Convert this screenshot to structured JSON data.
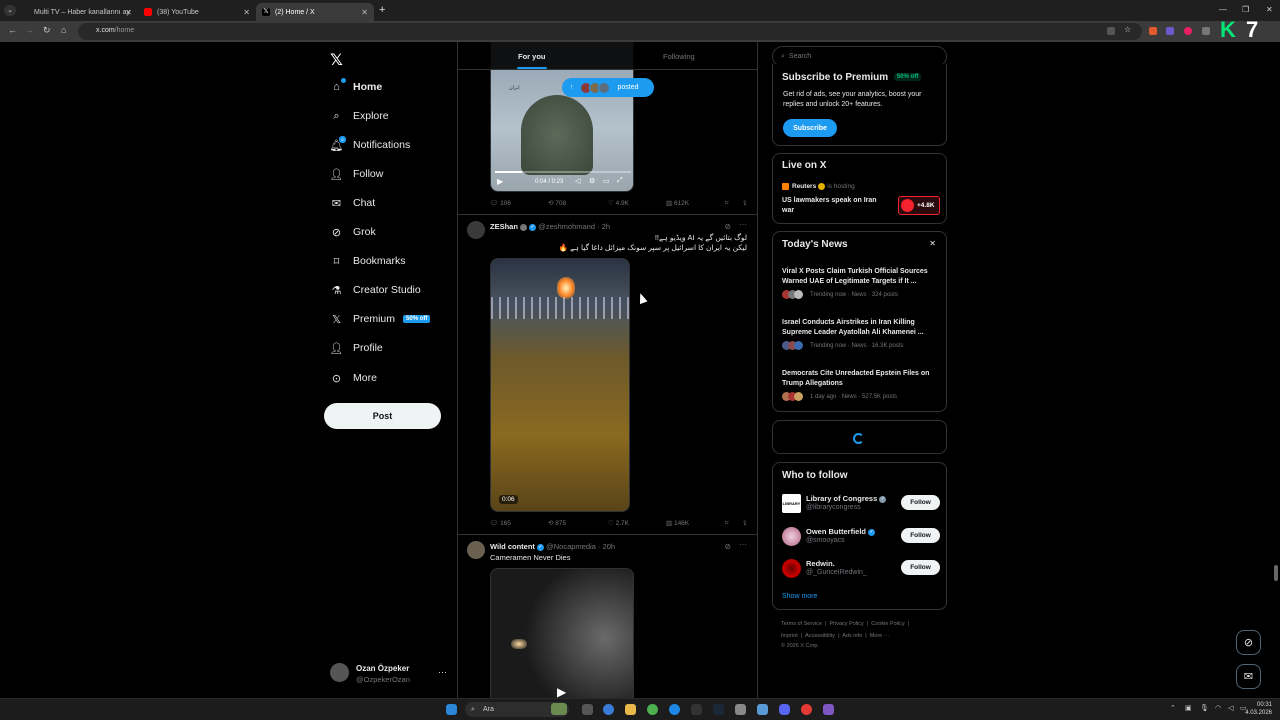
{
  "browser": {
    "tabs": [
      {
        "label": "Multi TV – Haber kanallarını ay",
        "active": false
      },
      {
        "label": "(38) YouTube",
        "active": false
      },
      {
        "label": "(2) Home / X",
        "active": true
      }
    ],
    "url_host": "x.com",
    "url_path": "/home",
    "overlay_logo_k": "K",
    "overlay_logo_num": "7"
  },
  "sidebar": {
    "items": [
      {
        "label": "Home",
        "icon": "home-icon"
      },
      {
        "label": "Explore",
        "icon": "search-icon"
      },
      {
        "label": "Notifications",
        "icon": "bell-icon"
      },
      {
        "label": "Follow",
        "icon": "person-add-icon"
      },
      {
        "label": "Chat",
        "icon": "mail-icon"
      },
      {
        "label": "Grok",
        "icon": "grok-icon"
      },
      {
        "label": "Bookmarks",
        "icon": "bookmark-icon"
      },
      {
        "label": "Creator Studio",
        "icon": "flask-icon"
      },
      {
        "label": "Premium",
        "icon": "x-logo-icon"
      },
      {
        "label": "Profile",
        "icon": "person-icon"
      },
      {
        "label": "More",
        "icon": "more-circle-icon"
      }
    ],
    "premium_badge": "50% off",
    "notifications_count": "2",
    "post_label": "Post",
    "account_name": "Ozan Özpeker",
    "account_handle": "@OzpekerOzan"
  },
  "timeline": {
    "tabs": [
      "For you",
      "Following"
    ],
    "posted_pill": "posted",
    "post1": {
      "video_time": "0:04 / 0:23",
      "media_caption": "ايران",
      "replies": "106",
      "reposts": "708",
      "likes": "4.9K",
      "views": "612K"
    },
    "post2": {
      "name": "ZEShan",
      "handle": "@zeshmohmand",
      "time": "· 2h",
      "line1": "لوگ بتائیں گے یہ AI ویڈیو ہے!!",
      "line2": "لیکن یہ ایران کا اسرائیل پر سپر سونک میزائل داغا گیا ہے 🔥",
      "duration": "0:06",
      "replies": "165",
      "reposts": "875",
      "likes": "2.7K",
      "views": "146K"
    },
    "post3": {
      "name": "Wild content",
      "handle": "@Nocapmedia",
      "time": "· 20h",
      "text": "Cameramen Never Dies"
    }
  },
  "right": {
    "search_placeholder": "Search",
    "premium": {
      "title": "Subscribe to Premium",
      "badge": "50% off",
      "desc": "Get rid of ads, see your analytics, boost your replies and unlock 20+ features.",
      "button": "Subscribe"
    },
    "live": {
      "title": "Live on X",
      "host": "Reuters",
      "hosting": "is hosting",
      "headline": "US lawmakers speak on Iran war",
      "count": "+4.8K"
    },
    "news": {
      "title": "Today's News",
      "items": [
        {
          "title": "Viral X Posts Claim Turkish Official Sources Warned UAE of Legitimate Targets if It ...",
          "meta": "Trending now · News · 324 posts"
        },
        {
          "title": "Israel Conducts Airstrikes in Iran Killing Supreme Leader Ayatollah Ali Khamenei ...",
          "meta": "Trending now · News · 16.3K posts"
        },
        {
          "title": "Democrats Cite Unredacted Epstein Files on Trump Allegations",
          "meta": "1 day ago · News · 527.5K posts"
        }
      ]
    },
    "who_to_follow": {
      "title": "Who to follow",
      "users": [
        {
          "name": "Library of Congress",
          "handle": "@librarycongress",
          "button": "Follow",
          "avatar_text": "LIBRARY"
        },
        {
          "name": "Owen Butterfield",
          "handle": "@smooyacs",
          "button": "Follow"
        },
        {
          "name": "Redwin.",
          "handle": "@_GunceIRedwin_",
          "button": "Follow"
        }
      ],
      "show_more": "Show more"
    },
    "footer": {
      "row1": [
        "Terms of Service",
        "Privacy Policy",
        "Cookie Policy"
      ],
      "row2": [
        "Imprint",
        "Accessibility",
        "Ads info",
        "More ···"
      ],
      "copyright": "© 2026 X Corp."
    }
  },
  "taskbar": {
    "search": "Ara",
    "time": "00:31",
    "date": "4.03.2026"
  },
  "colors": {
    "accent": "#1d9bf0",
    "background": "#000000",
    "border": "#2f3336",
    "muted": "#71767b"
  }
}
